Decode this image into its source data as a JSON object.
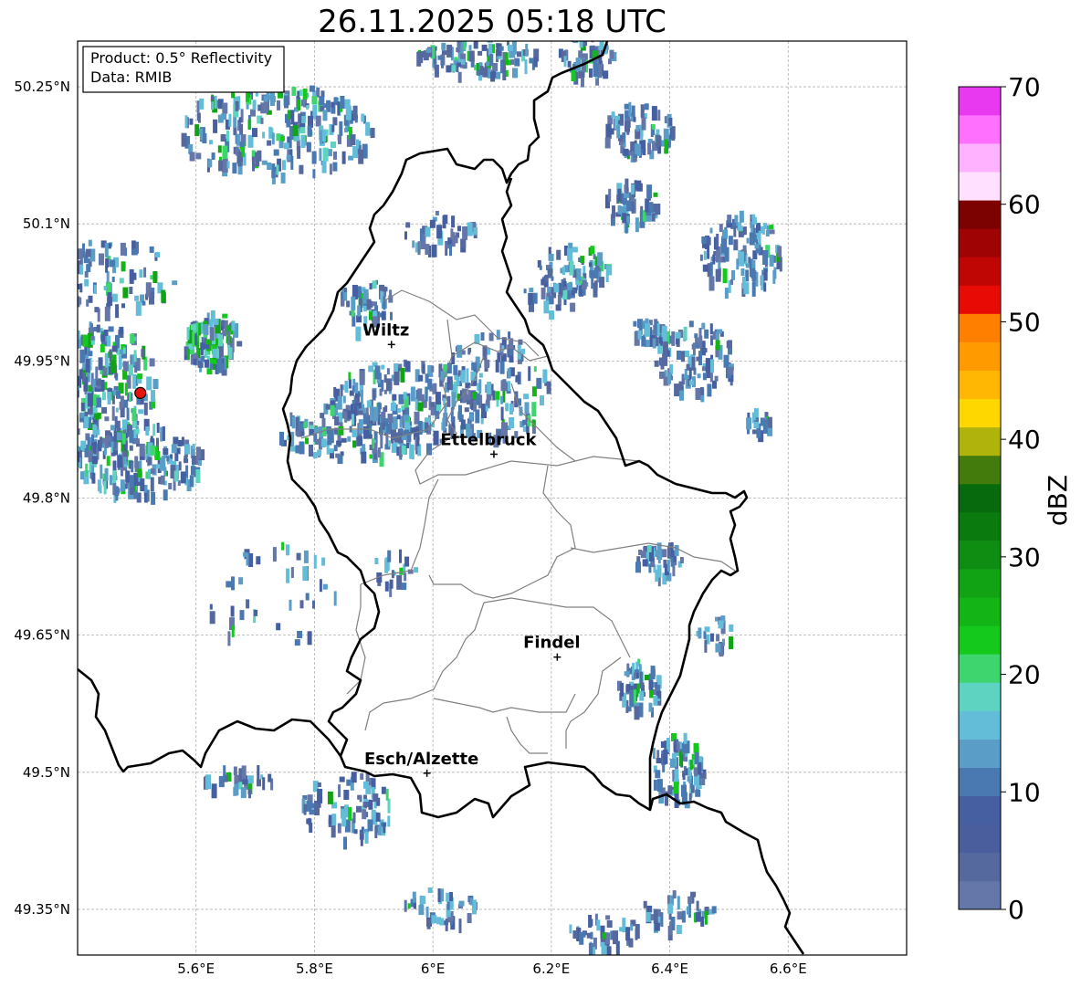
{
  "title": "26.11.2025 05:18 UTC",
  "info_box": {
    "line1": "Product: 0.5° Reflectivity",
    "line2": "Data: RMIB"
  },
  "lat_ticks": [
    {
      "value": 50.25,
      "label": "50.25°N"
    },
    {
      "value": 50.1,
      "label": "50.1°N"
    },
    {
      "value": 49.95,
      "label": "49.95°N"
    },
    {
      "value": 49.8,
      "label": "49.8°N"
    },
    {
      "value": 49.65,
      "label": "49.65°N"
    },
    {
      "value": 49.5,
      "label": "49.5°N"
    },
    {
      "value": 49.35,
      "label": "49.35°N"
    }
  ],
  "lon_ticks": [
    {
      "value": 5.6,
      "label": "5.6°E"
    },
    {
      "value": 5.8,
      "label": "5.8°E"
    },
    {
      "value": 6.0,
      "label": "6°E"
    },
    {
      "value": 6.2,
      "label": "6.2°E"
    },
    {
      "value": 6.4,
      "label": "6.4°E"
    },
    {
      "value": 6.6,
      "label": "6.6°E"
    }
  ],
  "extent": {
    "lon_min": 5.4,
    "lon_max": 6.8,
    "lat_min": 49.3,
    "lat_max": 50.3
  },
  "cities": [
    {
      "name": "Wiltz",
      "lon": 5.93,
      "lat": 49.968
    },
    {
      "name": "Ettelbruck",
      "lon": 6.103,
      "lat": 49.848
    },
    {
      "name": "Findel",
      "lon": 6.21,
      "lat": 49.626
    },
    {
      "name": "Esch/Alzette",
      "lon": 5.99,
      "lat": 49.499
    }
  ],
  "radar_site": {
    "lon": 5.506,
    "lat": 49.915,
    "color": "#e8120c"
  },
  "colorbar": {
    "label": "dBZ",
    "vmin": 0,
    "vmax": 70,
    "ticks": [
      "0",
      "10",
      "20",
      "30",
      "40",
      "50",
      "60",
      "70"
    ],
    "colors": [
      "#6577a8",
      "#56699e",
      "#4a5d9c",
      "#455fa0",
      "#4a78b0",
      "#5a9ec7",
      "#64bdd8",
      "#5ed3c2",
      "#3ed46e",
      "#14c81c",
      "#12b416",
      "#11a314",
      "#0f8c12",
      "#0a7a0f",
      "#076a0c",
      "#437b0c",
      "#b0b30b",
      "#ffd700",
      "#ffb703",
      "#ff9a00",
      "#ff7f00",
      "#e80b05",
      "#c00505",
      "#a00303",
      "#7c0101",
      "#ffe0ff",
      "#ffb2ff",
      "#ff70ff",
      "#e838f0"
    ]
  }
}
